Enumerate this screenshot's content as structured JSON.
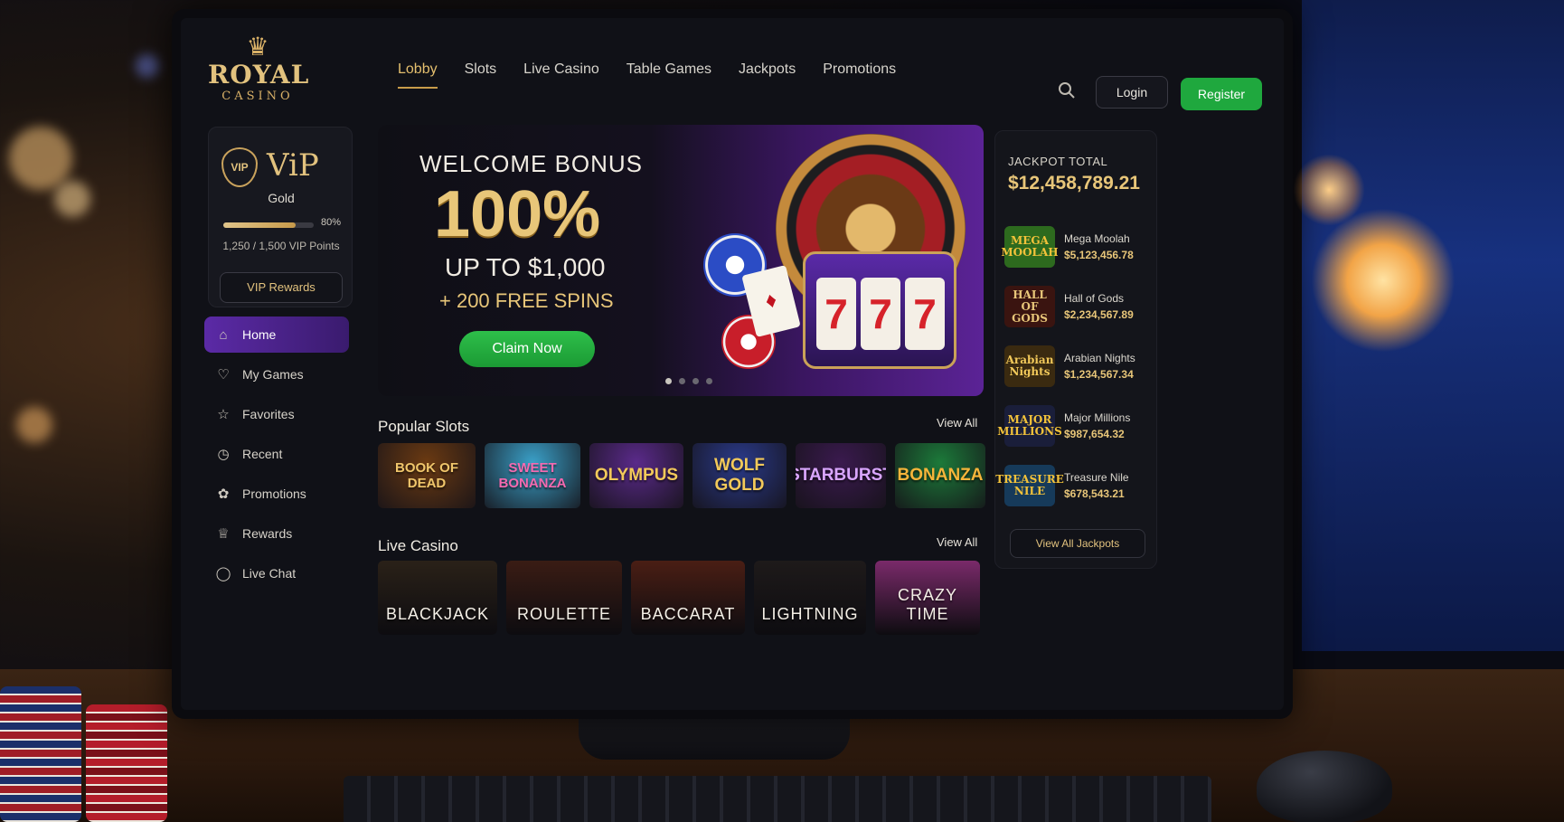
{
  "brand": {
    "logo_main": "ROYAL",
    "logo_sub": "CASINO"
  },
  "nav": {
    "items": [
      "Lobby",
      "Slots",
      "Live Casino",
      "Table Games",
      "Jackpots",
      "Promotions"
    ],
    "active": "Lobby",
    "login": "Login",
    "register": "Register"
  },
  "vip": {
    "badge": "VIP",
    "title": "ViP",
    "tier": "Gold",
    "progress_percent": 80,
    "progress_label": "80%",
    "points_label": "1,250 / 1,500 VIP Points",
    "rewards_button": "VIP Rewards"
  },
  "sidebar": {
    "items": [
      {
        "label": "Home",
        "icon": "home-icon",
        "active": true
      },
      {
        "label": "My Games",
        "icon": "gamepad-icon"
      },
      {
        "label": "Favorites",
        "icon": "star-icon"
      },
      {
        "label": "Recent",
        "icon": "clock-icon"
      },
      {
        "label": "Promotions",
        "icon": "gift-icon"
      },
      {
        "label": "Rewards",
        "icon": "trophy-icon"
      },
      {
        "label": "Live Chat",
        "icon": "chat-icon"
      }
    ]
  },
  "hero": {
    "line1": "WELCOME BONUS",
    "line2": "100%",
    "line3": "UP TO $1,000",
    "line4": "+ 200 FREE SPINS",
    "cta": "Claim Now",
    "reel_symbol": "7",
    "card_symbol": "♦",
    "slides": 4,
    "active_slide": 1
  },
  "popular_slots": {
    "title": "Popular Slots",
    "view_all": "View All",
    "games": [
      {
        "name": "BOOK OF DEAD",
        "bg": "#6b3a12",
        "fg": "#f0c66b"
      },
      {
        "name": "SWEET BONANZA",
        "bg": "#3aa0c8",
        "fg": "#f46ab0"
      },
      {
        "name": "OLYMPUS",
        "bg": "#5a2a8a",
        "fg": "#f2c95a"
      },
      {
        "name": "WOLF GOLD",
        "bg": "#2a3a8a",
        "fg": "#f2c95a"
      },
      {
        "name": "STARBURST",
        "bg": "#3a1a4e",
        "fg": "#d9a6ff"
      },
      {
        "name": "BONANZA",
        "bg": "#1c7a3a",
        "fg": "#f5b53a"
      }
    ]
  },
  "live_casino": {
    "title": "Live Casino",
    "view_all": "View All",
    "games": [
      {
        "name": "BLACKJACK",
        "bg": "#2a2118"
      },
      {
        "name": "ROULETTE",
        "bg": "#3a1c14"
      },
      {
        "name": "BACCARAT",
        "bg": "#4a1e14"
      },
      {
        "name": "LIGHTNING",
        "bg": "#1e1a1a"
      },
      {
        "name": "CRAZY TIME",
        "bg": "#7a2a6a"
      }
    ]
  },
  "jackpots": {
    "total_label": "JACKPOT TOTAL",
    "total": "$12,458,789.21",
    "items": [
      {
        "logo": "MEGA MOOLAH",
        "name": "Mega Moolah",
        "amount": "$5,123,456.78",
        "bg": "#2d6a1e",
        "fg": "#f2c23a"
      },
      {
        "logo": "HALL OF GODS",
        "name": "Hall of Gods",
        "amount": "$2,234,567.89",
        "bg": "#3a1410",
        "fg": "#e8c679"
      },
      {
        "logo": "Arabian Nights",
        "name": "Arabian Nights",
        "amount": "$1,234,567.34",
        "bg": "#3a2a10",
        "fg": "#f2c95a"
      },
      {
        "logo": "MAJOR MILLIONS",
        "name": "Major Millions",
        "amount": "$987,654.32",
        "bg": "#1a1e3a",
        "fg": "#f2c23a"
      },
      {
        "logo": "TREASURE NILE",
        "name": "Treasure Nile",
        "amount": "$678,543.21",
        "bg": "#163a5a",
        "fg": "#f2c23a"
      }
    ],
    "view_all": "View All Jackpots"
  }
}
